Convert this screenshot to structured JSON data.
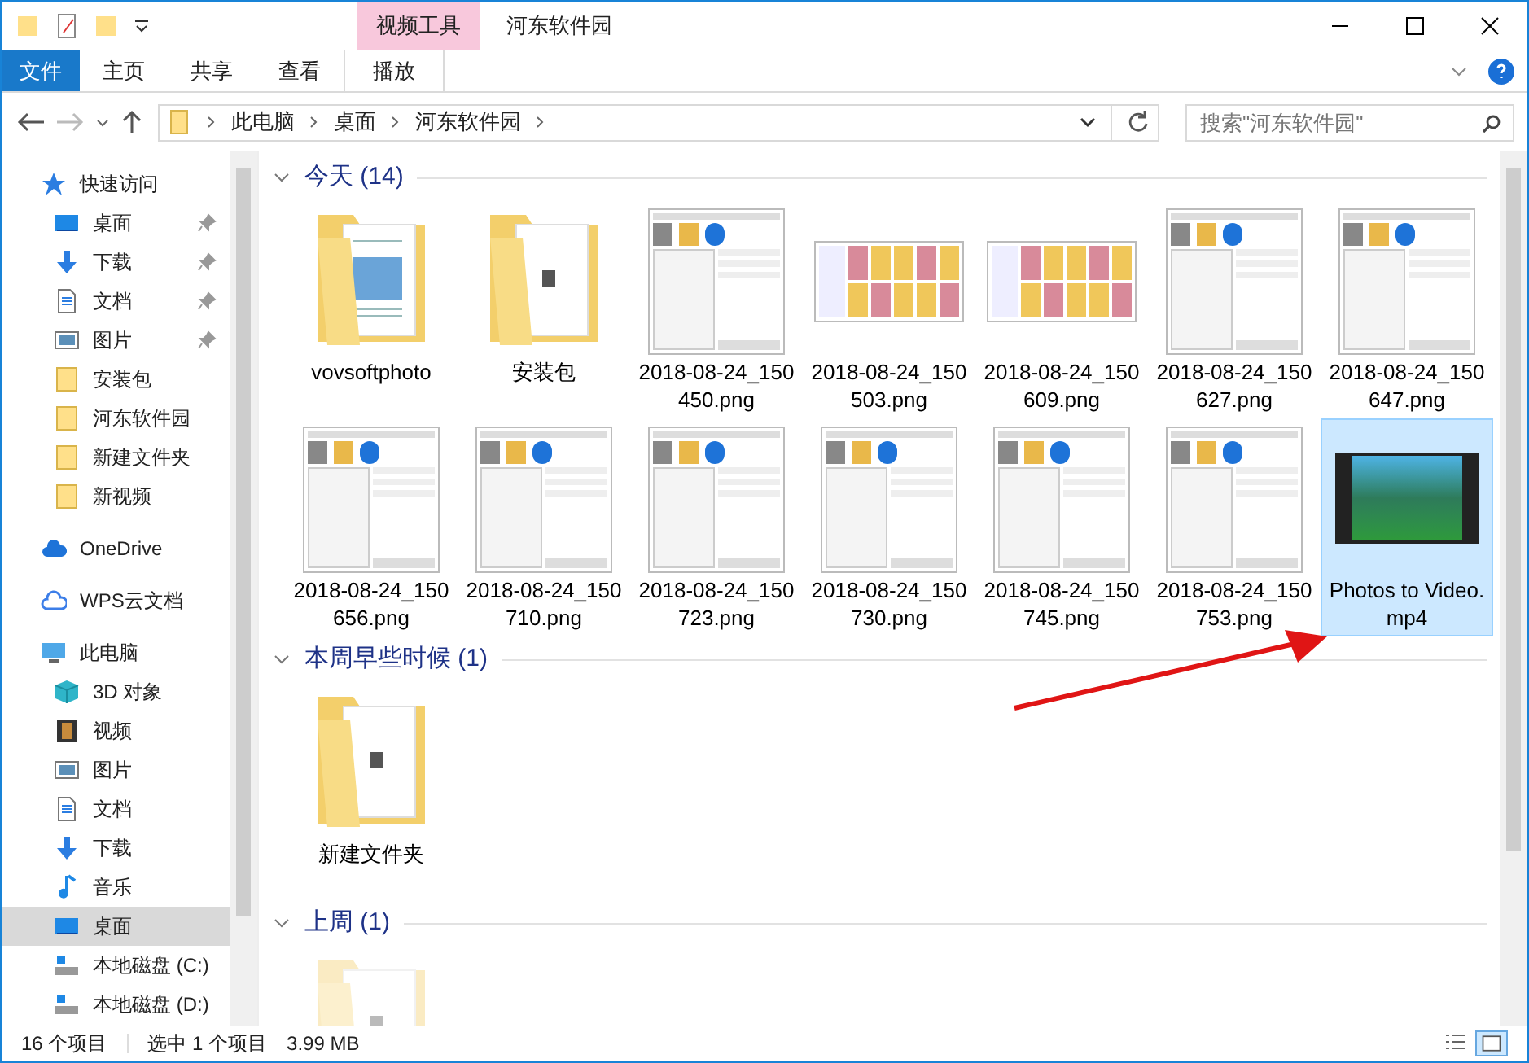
{
  "window": {
    "title": "河东软件园",
    "context_tab": "视频工具"
  },
  "ribbon": {
    "tabs": [
      {
        "label": "文件",
        "selected": false,
        "kind": "file"
      },
      {
        "label": "主页",
        "selected": false,
        "kind": "tab"
      },
      {
        "label": "共享",
        "selected": false,
        "kind": "tab"
      },
      {
        "label": "查看",
        "selected": false,
        "kind": "tab"
      },
      {
        "label": "播放",
        "selected": false,
        "kind": "context"
      }
    ]
  },
  "address": {
    "path": [
      "此电脑",
      "桌面",
      "河东软件园"
    ],
    "search_placeholder": "搜索\"河东软件园\""
  },
  "sidebar": {
    "items": [
      {
        "label": "快速访问",
        "kind": "star",
        "children": [
          {
            "label": "桌面",
            "kind": "desktop",
            "pinned": true,
            "selected": false
          },
          {
            "label": "下载",
            "kind": "download",
            "pinned": true,
            "selected": false
          },
          {
            "label": "文档",
            "kind": "document",
            "pinned": true,
            "selected": false
          },
          {
            "label": "图片",
            "kind": "picture",
            "pinned": true,
            "selected": false
          },
          {
            "label": "安装包",
            "kind": "folder",
            "pinned": false,
            "selected": false
          },
          {
            "label": "河东软件园",
            "kind": "folder",
            "pinned": false,
            "selected": false
          },
          {
            "label": "新建文件夹",
            "kind": "folder",
            "pinned": false,
            "selected": false
          },
          {
            "label": "新视频",
            "kind": "folder",
            "pinned": false,
            "selected": false
          }
        ]
      },
      {
        "label": "OneDrive",
        "kind": "cloud"
      },
      {
        "label": "WPS云文档",
        "kind": "cloud-outline"
      },
      {
        "label": "此电脑",
        "kind": "pc",
        "children": [
          {
            "label": "3D 对象",
            "kind": "cube",
            "pinned": false,
            "selected": false
          },
          {
            "label": "视频",
            "kind": "film",
            "pinned": false,
            "selected": false
          },
          {
            "label": "图片",
            "kind": "picture",
            "pinned": false,
            "selected": false
          },
          {
            "label": "文档",
            "kind": "document",
            "pinned": false,
            "selected": false
          },
          {
            "label": "下载",
            "kind": "download",
            "pinned": false,
            "selected": false
          },
          {
            "label": "音乐",
            "kind": "music",
            "pinned": false,
            "selected": false
          },
          {
            "label": "桌面",
            "kind": "desktop",
            "pinned": false,
            "selected": true
          },
          {
            "label": "本地磁盘 (C:)",
            "kind": "drive",
            "pinned": false,
            "selected": false
          },
          {
            "label": "本地磁盘 (D:)",
            "kind": "drive",
            "pinned": false,
            "selected": false
          }
        ]
      }
    ]
  },
  "groups": [
    {
      "title": "今天 (14)",
      "expanded": true,
      "items": [
        {
          "name": "vovsoftphoto",
          "kind": "folder-docs",
          "selected": false
        },
        {
          "name": "安装包",
          "kind": "folder-paper",
          "selected": false
        },
        {
          "name": "2018-08-24_150450.png",
          "kind": "screenshot",
          "selected": false
        },
        {
          "name": "2018-08-24_150503.png",
          "kind": "explorer-shot",
          "selected": false
        },
        {
          "name": "2018-08-24_150609.png",
          "kind": "explorer-shot",
          "selected": false
        },
        {
          "name": "2018-08-24_150627.png",
          "kind": "screenshot",
          "selected": false
        },
        {
          "name": "2018-08-24_150647.png",
          "kind": "screenshot",
          "selected": false
        },
        {
          "name": "2018-08-24_150656.png",
          "kind": "screenshot",
          "selected": false
        },
        {
          "name": "2018-08-24_150710.png",
          "kind": "screenshot",
          "selected": false
        },
        {
          "name": "2018-08-24_150723.png",
          "kind": "screenshot",
          "selected": false
        },
        {
          "name": "2018-08-24_150730.png",
          "kind": "screenshot",
          "selected": false
        },
        {
          "name": "2018-08-24_150745.png",
          "kind": "screenshot",
          "selected": false
        },
        {
          "name": "2018-08-24_150753.png",
          "kind": "screenshot",
          "selected": false
        },
        {
          "name": "Photos to Video.mp4",
          "kind": "video",
          "selected": true
        }
      ]
    },
    {
      "title": "本周早些时候 (1)",
      "expanded": true,
      "items": [
        {
          "name": "新建文件夹",
          "kind": "folder-paper",
          "selected": false
        }
      ]
    },
    {
      "title": "上周 (1)",
      "expanded": true,
      "items": [
        {
          "kind": "folder-faded",
          "selected": false
        }
      ]
    }
  ],
  "status_bar": {
    "count": "16 个项目",
    "selection": "选中 1 个项目",
    "size": "3.99 MB"
  }
}
